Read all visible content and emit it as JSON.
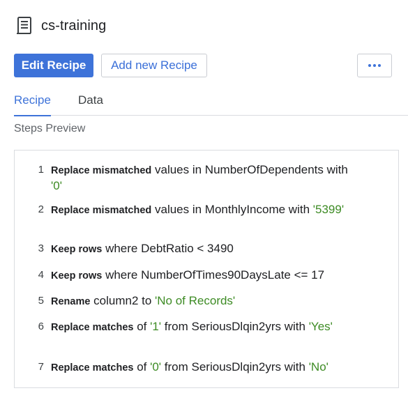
{
  "header": {
    "title": "cs-training",
    "icon": "recipe-icon"
  },
  "toolbar": {
    "edit_label": "Edit Recipe",
    "add_label": "Add new Recipe",
    "more_icon": "more-horizontal-icon",
    "accent_color": "#3e73d9"
  },
  "tabs": [
    {
      "label": "Recipe",
      "active": true
    },
    {
      "label": "Data",
      "active": false
    }
  ],
  "steps_preview_label": "Steps Preview",
  "steps": [
    {
      "num": "1",
      "parts": [
        {
          "t": "Replace mismatched",
          "s": "kw"
        },
        {
          "t": " values in NumberOfDependents with ",
          "s": "txt"
        },
        {
          "t": "'0'",
          "s": "str"
        }
      ]
    },
    {
      "num": "2",
      "parts": [
        {
          "t": "Replace mismatched",
          "s": "kw"
        },
        {
          "t": " values in MonthlyIncome with ",
          "s": "txt"
        },
        {
          "t": "'5399'",
          "s": "str"
        }
      ]
    },
    {
      "num": "3",
      "parts": [
        {
          "t": "Keep rows",
          "s": "kw"
        },
        {
          "t": " where DebtRatio < 3490",
          "s": "txt"
        }
      ]
    },
    {
      "num": "4",
      "parts": [
        {
          "t": "Keep rows",
          "s": "kw"
        },
        {
          "t": " where NumberOfTimes90DaysLate <= 17",
          "s": "txt"
        }
      ]
    },
    {
      "num": "5",
      "parts": [
        {
          "t": "Rename",
          "s": "kw"
        },
        {
          "t": " column2 to ",
          "s": "txt"
        },
        {
          "t": "'No of Records'",
          "s": "str"
        }
      ]
    },
    {
      "num": "6",
      "parts": [
        {
          "t": "Replace matches",
          "s": "kw"
        },
        {
          "t": " of ",
          "s": "txt"
        },
        {
          "t": "'1'",
          "s": "str"
        },
        {
          "t": " from SeriousDlqin2yrs with ",
          "s": "txt"
        },
        {
          "t": "'Yes'",
          "s": "str"
        }
      ]
    },
    {
      "num": "7",
      "parts": [
        {
          "t": "Replace matches",
          "s": "kw"
        },
        {
          "t": " of ",
          "s": "txt"
        },
        {
          "t": "'0'",
          "s": "str"
        },
        {
          "t": " from SeriousDlqin2yrs with ",
          "s": "txt"
        },
        {
          "t": "'No'",
          "s": "str"
        }
      ]
    }
  ]
}
